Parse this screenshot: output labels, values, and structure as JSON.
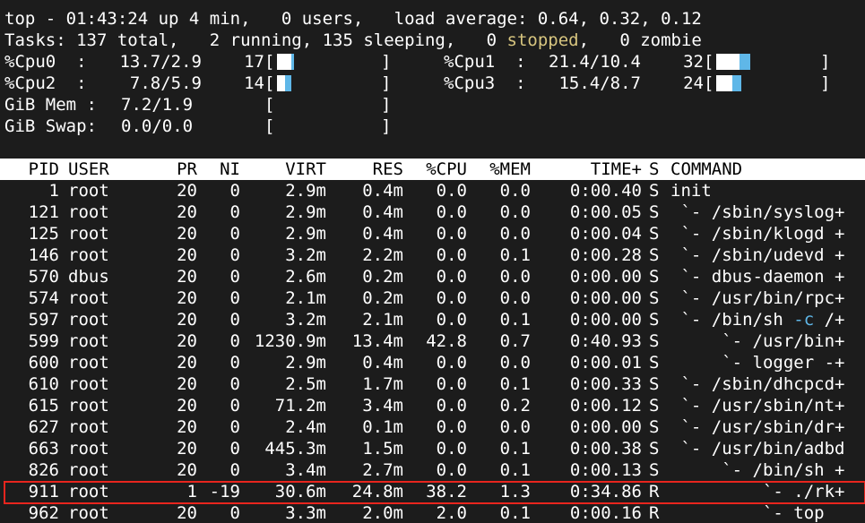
{
  "summary": {
    "uptime_line": "top - 01:43:24 up 4 min,   0 users,   load average: 0.64, 0.32, 0.12",
    "tasks_prefix": "Tasks: 137 total,   2 running, 135 sleeping,   0 ",
    "tasks_stopped": "stopped",
    "tasks_suffix": ",   0 zombie"
  },
  "cpu_meters": [
    {
      "label": "%Cpu0  :",
      "value": "13.7/2.9",
      "total": "17",
      "user_pct": 13.7,
      "sys_pct": 2.9
    },
    {
      "label": "%Cpu1  :",
      "value": "21.4/10.4",
      "total": "32",
      "user_pct": 21.4,
      "sys_pct": 10.4
    },
    {
      "label": "%Cpu2  :",
      "value": "7.8/5.9",
      "total": "14",
      "user_pct": 7.8,
      "sys_pct": 5.9
    },
    {
      "label": "%Cpu3  :",
      "value": "15.4/8.7",
      "total": "24",
      "user_pct": 15.4,
      "sys_pct": 8.7
    }
  ],
  "mem": {
    "label": "GiB Mem :",
    "value": "7.2/1.9"
  },
  "swap": {
    "label": "GiB Swap:",
    "value": "0.0/0.0"
  },
  "columns": [
    "PID",
    "USER",
    "PR",
    "NI",
    "VIRT",
    "RES",
    "%CPU",
    "%MEM",
    "TIME+",
    "S",
    "COMMAND"
  ],
  "processes": [
    {
      "pid": "1",
      "user": "root",
      "pr": "20",
      "ni": "0",
      "virt": "2.9m",
      "res": "0.4m",
      "cpu": "0.0",
      "mem": "0.0",
      "time": "0:00.40",
      "s": "S",
      "cmd_prefix": "init",
      "cmd_arg": "",
      "cmd_suffix": ""
    },
    {
      "pid": "121",
      "user": "root",
      "pr": "20",
      "ni": "0",
      "virt": "2.9m",
      "res": "0.4m",
      "cpu": "0.0",
      "mem": "0.0",
      "time": "0:00.05",
      "s": "S",
      "cmd_prefix": " `- /sbin/syslog+",
      "cmd_arg": "",
      "cmd_suffix": ""
    },
    {
      "pid": "125",
      "user": "root",
      "pr": "20",
      "ni": "0",
      "virt": "2.9m",
      "res": "0.4m",
      "cpu": "0.0",
      "mem": "0.0",
      "time": "0:00.04",
      "s": "S",
      "cmd_prefix": " `- /sbin/klogd +",
      "cmd_arg": "",
      "cmd_suffix": ""
    },
    {
      "pid": "146",
      "user": "root",
      "pr": "20",
      "ni": "0",
      "virt": "3.2m",
      "res": "2.2m",
      "cpu": "0.0",
      "mem": "0.1",
      "time": "0:00.28",
      "s": "S",
      "cmd_prefix": " `- /sbin/udevd +",
      "cmd_arg": "",
      "cmd_suffix": ""
    },
    {
      "pid": "570",
      "user": "dbus",
      "pr": "20",
      "ni": "0",
      "virt": "2.6m",
      "res": "0.2m",
      "cpu": "0.0",
      "mem": "0.0",
      "time": "0:00.00",
      "s": "S",
      "cmd_prefix": " `- dbus-daemon +",
      "cmd_arg": "",
      "cmd_suffix": ""
    },
    {
      "pid": "574",
      "user": "root",
      "pr": "20",
      "ni": "0",
      "virt": "2.1m",
      "res": "0.2m",
      "cpu": "0.0",
      "mem": "0.0",
      "time": "0:00.00",
      "s": "S",
      "cmd_prefix": " `- /usr/bin/rpc+",
      "cmd_arg": "",
      "cmd_suffix": ""
    },
    {
      "pid": "597",
      "user": "root",
      "pr": "20",
      "ni": "0",
      "virt": "3.2m",
      "res": "2.1m",
      "cpu": "0.0",
      "mem": "0.1",
      "time": "0:00.00",
      "s": "S",
      "cmd_prefix": " `- /bin/sh ",
      "cmd_arg": "-c",
      "cmd_suffix": " /+"
    },
    {
      "pid": "599",
      "user": "root",
      "pr": "20",
      "ni": "0",
      "virt": "1230.9m",
      "res": "13.4m",
      "cpu": "42.8",
      "mem": "0.7",
      "time": "0:40.93",
      "s": "S",
      "cmd_prefix": "     `- /usr/bin+",
      "cmd_arg": "",
      "cmd_suffix": ""
    },
    {
      "pid": "600",
      "user": "root",
      "pr": "20",
      "ni": "0",
      "virt": "2.9m",
      "res": "0.4m",
      "cpu": "0.0",
      "mem": "0.0",
      "time": "0:00.01",
      "s": "S",
      "cmd_prefix": "     `- logger -+",
      "cmd_arg": "",
      "cmd_suffix": ""
    },
    {
      "pid": "610",
      "user": "root",
      "pr": "20",
      "ni": "0",
      "virt": "2.5m",
      "res": "1.7m",
      "cpu": "0.0",
      "mem": "0.1",
      "time": "0:00.33",
      "s": "S",
      "cmd_prefix": " `- /sbin/dhcpcd+",
      "cmd_arg": "",
      "cmd_suffix": ""
    },
    {
      "pid": "615",
      "user": "root",
      "pr": "20",
      "ni": "0",
      "virt": "71.2m",
      "res": "3.4m",
      "cpu": "0.0",
      "mem": "0.2",
      "time": "0:00.12",
      "s": "S",
      "cmd_prefix": " `- /usr/sbin/nt+",
      "cmd_arg": "",
      "cmd_suffix": ""
    },
    {
      "pid": "627",
      "user": "root",
      "pr": "20",
      "ni": "0",
      "virt": "2.4m",
      "res": "0.1m",
      "cpu": "0.0",
      "mem": "0.0",
      "time": "0:00.00",
      "s": "S",
      "cmd_prefix": " `- /usr/sbin/dr+",
      "cmd_arg": "",
      "cmd_suffix": ""
    },
    {
      "pid": "663",
      "user": "root",
      "pr": "20",
      "ni": "0",
      "virt": "445.3m",
      "res": "1.5m",
      "cpu": "0.0",
      "mem": "0.1",
      "time": "0:00.38",
      "s": "S",
      "cmd_prefix": " `- /usr/bin/adbd",
      "cmd_arg": "",
      "cmd_suffix": ""
    },
    {
      "pid": "826",
      "user": "root",
      "pr": "20",
      "ni": "0",
      "virt": "3.4m",
      "res": "2.7m",
      "cpu": "0.0",
      "mem": "0.1",
      "time": "0:00.13",
      "s": "S",
      "cmd_prefix": "     `- /bin/sh +",
      "cmd_arg": "",
      "cmd_suffix": ""
    },
    {
      "pid": "911",
      "user": "root",
      "pr": "1",
      "ni": "-19",
      "virt": "30.6m",
      "res": "24.8m",
      "cpu": "38.2",
      "mem": "1.3",
      "time": "0:34.86",
      "s": "R",
      "cmd_prefix": "         `- ./rk+",
      "cmd_arg": "",
      "cmd_suffix": ""
    },
    {
      "pid": "962",
      "user": "root",
      "pr": "20",
      "ni": "0",
      "virt": "3.3m",
      "res": "2.0m",
      "cpu": "2.0",
      "mem": "0.1",
      "time": "0:00.16",
      "s": "R",
      "cmd_prefix": "         `- top",
      "cmd_arg": "",
      "cmd_suffix": ""
    }
  ],
  "colors": {
    "sys_bar": "#5fb7e8",
    "selection_box": "#e8251e",
    "stopped": "#d7c57f"
  }
}
